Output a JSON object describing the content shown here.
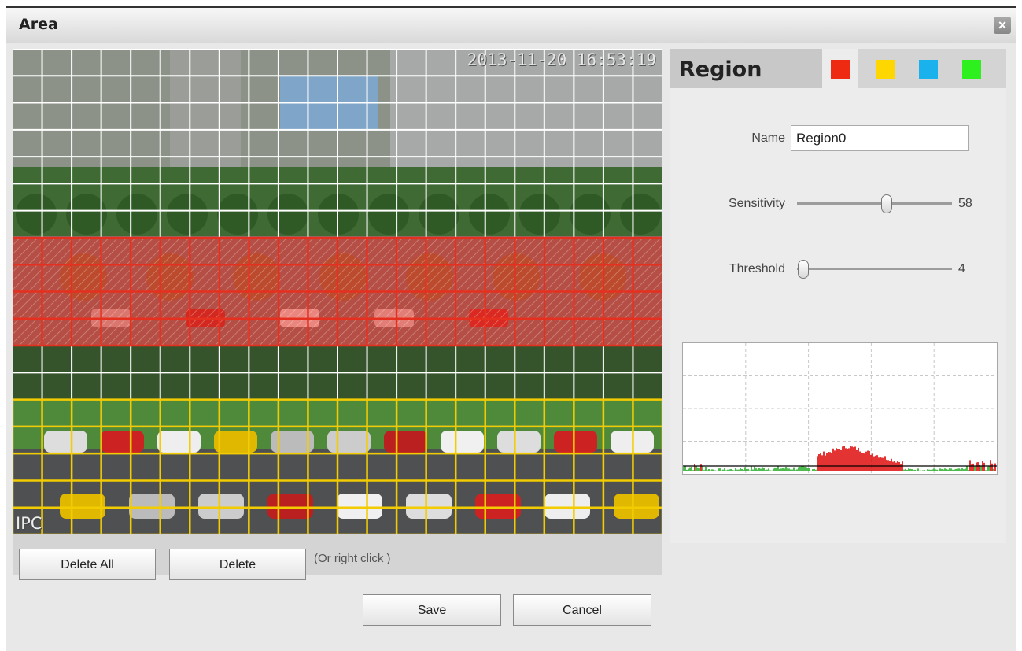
{
  "window": {
    "title": "Area",
    "close_icon": "close-icon"
  },
  "video": {
    "timestamp": "2013-11-20 16:53:19",
    "camera_label": "IPC",
    "grid": {
      "columns": 22,
      "rows": 18
    },
    "regions": [
      {
        "color": "#e53020",
        "row_start": 7,
        "row_end": 10
      },
      {
        "color": "#f2cc00",
        "row_start": 13,
        "row_end": 17
      }
    ]
  },
  "controls": {
    "delete_all_label": "Delete All",
    "delete_label": "Delete",
    "hint": "(Or right click )",
    "save_label": "Save",
    "cancel_label": "Cancel"
  },
  "panel": {
    "title": "Region",
    "color_tabs": [
      {
        "name": "red",
        "color": "#ee2a12"
      },
      {
        "name": "yellow",
        "color": "#ffd700"
      },
      {
        "name": "blue",
        "color": "#1ab2ec"
      },
      {
        "name": "green",
        "color": "#2ef01f"
      }
    ],
    "name_label": "Name",
    "name_value": "Region0",
    "sensitivity_label": "Sensitivity",
    "sensitivity_value": "58",
    "threshold_label": "Threshold",
    "threshold_value": "4",
    "sensitivity_fraction": 0.58,
    "threshold_fraction": 0.04
  },
  "graph": {
    "threshold_color": "#000000",
    "above_color": "#dd0000",
    "below_color": "#22aa22"
  }
}
